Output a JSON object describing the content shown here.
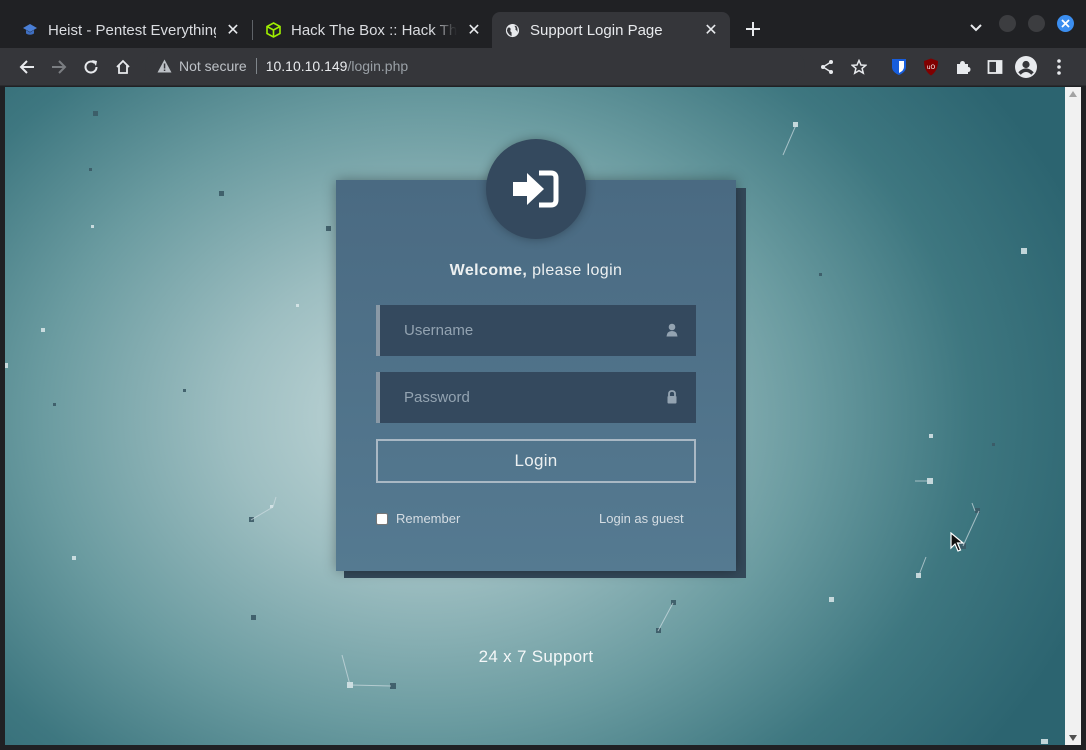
{
  "tabs": [
    {
      "label": "Heist - Pentest Everything",
      "favicon": "graduation-cap-icon",
      "active": false
    },
    {
      "label": "Hack The Box :: Hack The Box",
      "favicon": "htb-cube-icon",
      "active": false
    },
    {
      "label": "Support Login Page",
      "favicon": "globe-icon",
      "active": true
    }
  ],
  "toolbar": {
    "security_label": "Not secure",
    "url_host": "10.10.10.149",
    "url_path": "/login.php"
  },
  "login": {
    "welcome_bold": "Welcome,",
    "welcome_rest": " please login",
    "username_placeholder": "Username",
    "password_placeholder": "Password",
    "login_button": "Login",
    "remember_label": "Remember",
    "guest_link": "Login as guest"
  },
  "footer": {
    "support_text": "24 x 7 Support"
  },
  "colors": {
    "card": "#4f7089",
    "field": "#34495e",
    "accent": "#3b8ef0"
  }
}
